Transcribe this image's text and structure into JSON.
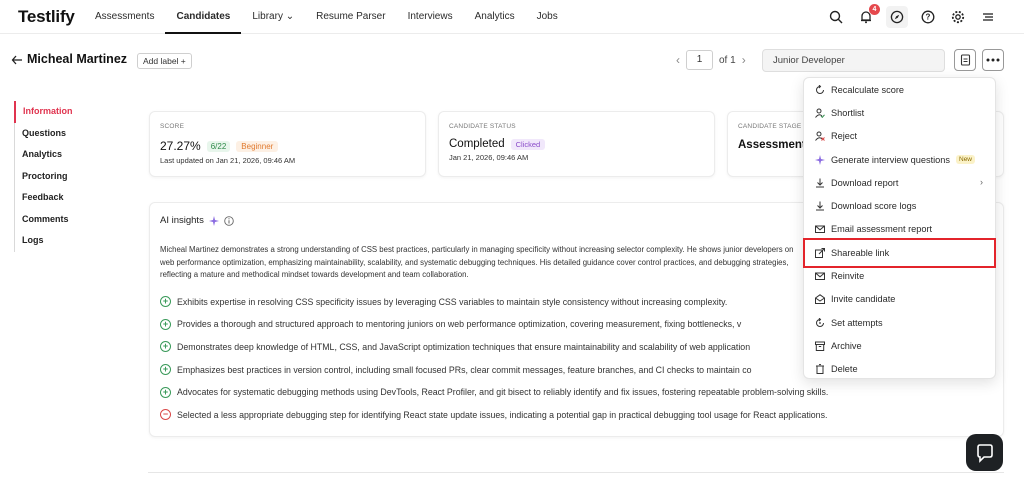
{
  "brand": "Testlify",
  "nav": [
    {
      "label": "Assessments"
    },
    {
      "label": "Candidates",
      "active": true
    },
    {
      "label": "Library ⌄"
    },
    {
      "label": "Resume Parser"
    },
    {
      "label": "Interviews"
    },
    {
      "label": "Analytics"
    },
    {
      "label": "Jobs"
    }
  ],
  "notifications_count": "4",
  "candidate": {
    "name": "Micheal Martinez",
    "add_label": "Add label +"
  },
  "pager": {
    "current": "1",
    "total": "of 1"
  },
  "role": "Junior Developer",
  "sidenav": [
    "Information",
    "Questions",
    "Analytics",
    "Proctoring",
    "Feedback",
    "Comments",
    "Logs"
  ],
  "score_card": {
    "label": "SCORE",
    "score": "27.27%",
    "fraction": "6/22",
    "level": "Beginner",
    "updated": "Last updated on Jan 21, 2026, 09:46 AM"
  },
  "status_card": {
    "label": "CANDIDATE STATUS",
    "status": "Completed",
    "tag": "Clicked",
    "date": "Jan 21, 2026, 09:46 AM"
  },
  "stage_card": {
    "label": "CANDIDATE STAGE",
    "stage": "Assessment c"
  },
  "ai": {
    "title": "AI insights",
    "summary": "Micheal Martinez demonstrates a strong understanding of CSS best practices, particularly in managing specificity without increasing selector complexity. He shows junior developers on web performance optimization, emphasizing maintainability, scalability, and systematic debugging techniques. His detailed guidance cover control practices, and debugging strategies, reflecting a mature and methodical mindset towards development and team collaboration.",
    "insights": [
      {
        "kind": "pos",
        "text": "Exhibits expertise in resolving CSS specificity issues by leveraging CSS variables to maintain style consistency without increasing complexity."
      },
      {
        "kind": "pos",
        "text": "Provides a thorough and structured approach to mentoring juniors on web performance optimization, covering measurement, fixing bottlenecks, v"
      },
      {
        "kind": "pos",
        "text": "Demonstrates deep knowledge of HTML, CSS, and JavaScript optimization techniques that ensure maintainability and scalability of web application"
      },
      {
        "kind": "pos",
        "text": "Emphasizes best practices in version control, including small focused PRs, clear commit messages, feature branches, and CI checks to maintain co"
      },
      {
        "kind": "pos",
        "text": "Advocates for systematic debugging methods using DevTools, React Profiler, and git bisect to reliably identify and fix issues, fostering repeatable problem-solving skills."
      },
      {
        "kind": "neg",
        "text": "Selected a less appropriate debugging step for identifying React state update issues, indicating a potential gap in practical debugging tool usage for React applications."
      }
    ]
  },
  "menu": [
    {
      "label": "Recalculate score",
      "icon": "recalculate-icon"
    },
    {
      "label": "Shortlist",
      "icon": "user-check-icon"
    },
    {
      "label": "Reject",
      "icon": "user-x-icon"
    },
    {
      "label": "Generate interview questions",
      "icon": "sparkle-icon",
      "badge": "New"
    },
    {
      "label": "Download report",
      "icon": "download-icon",
      "submenu": true
    },
    {
      "label": "Download score logs",
      "icon": "download-icon"
    },
    {
      "label": "Email assessment report",
      "icon": "mail-icon"
    },
    {
      "label": "Shareable link",
      "icon": "share-icon"
    },
    {
      "label": "Reinvite",
      "icon": "reinvite-icon"
    },
    {
      "label": "Invite candidate",
      "icon": "invite-icon"
    },
    {
      "label": "Set attempts",
      "icon": "attempts-icon"
    },
    {
      "label": "Archive",
      "icon": "archive-icon"
    },
    {
      "label": "Delete",
      "icon": "trash-icon"
    }
  ],
  "colors": {
    "accent": "#e0344f",
    "highlight": "#e3242b",
    "positive": "#3a9a5a",
    "negative": "#d94848"
  }
}
